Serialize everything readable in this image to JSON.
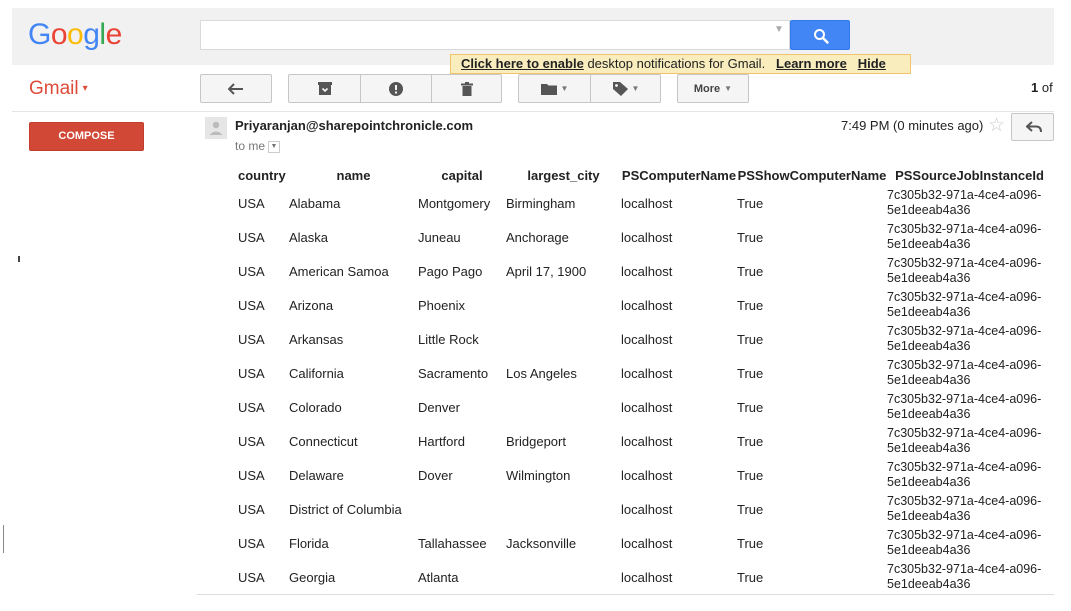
{
  "header": {
    "logo_letters": [
      {
        "ch": "G",
        "color": "#4285f4"
      },
      {
        "ch": "o",
        "color": "#ea4335"
      },
      {
        "ch": "o",
        "color": "#fbbc05"
      },
      {
        "ch": "g",
        "color": "#4285f4"
      },
      {
        "ch": "l",
        "color": "#34a853"
      },
      {
        "ch": "e",
        "color": "#ea4335"
      }
    ],
    "search_value": "",
    "search_icon": "search-icon"
  },
  "notification": {
    "link_text": "Click here to enable",
    "rest_text": " desktop notifications for Gmail.",
    "learn_more": "Learn more",
    "hide": "Hide"
  },
  "app": {
    "label": "Gmail",
    "caret": "▾",
    "compose": "COMPOSE"
  },
  "toolbar": {
    "more_label": "More",
    "pager_current": "1",
    "pager_of": " of"
  },
  "message": {
    "sender": "Priyaranjan@sharepointchronicle.com",
    "to": "to me",
    "time": "7:49 PM (0 minutes ago)",
    "star": "☆"
  },
  "table": {
    "headers": [
      "country",
      "name",
      "capital",
      "largest_city",
      "PSComputerName",
      "PSShowComputerName",
      "PSSourceJobInstanceId"
    ],
    "rows": [
      [
        "USA",
        "Alabama",
        "Montgomery",
        "Birmingham",
        "localhost",
        "True",
        "7c305b32-971a-4ce4-a096-5e1deeab4a36"
      ],
      [
        "USA",
        "Alaska",
        "Juneau",
        "Anchorage",
        "localhost",
        "True",
        "7c305b32-971a-4ce4-a096-5e1deeab4a36"
      ],
      [
        "USA",
        "American Samoa",
        "Pago Pago",
        "April 17, 1900",
        "localhost",
        "True",
        "7c305b32-971a-4ce4-a096-5e1deeab4a36"
      ],
      [
        "USA",
        "Arizona",
        "Phoenix",
        "",
        "localhost",
        "True",
        "7c305b32-971a-4ce4-a096-5e1deeab4a36"
      ],
      [
        "USA",
        "Arkansas",
        "Little Rock",
        "",
        "localhost",
        "True",
        "7c305b32-971a-4ce4-a096-5e1deeab4a36"
      ],
      [
        "USA",
        "California",
        "Sacramento",
        "Los Angeles",
        "localhost",
        "True",
        "7c305b32-971a-4ce4-a096-5e1deeab4a36"
      ],
      [
        "USA",
        "Colorado",
        "Denver",
        "",
        "localhost",
        "True",
        "7c305b32-971a-4ce4-a096-5e1deeab4a36"
      ],
      [
        "USA",
        "Connecticut",
        "Hartford",
        "Bridgeport",
        "localhost",
        "True",
        "7c305b32-971a-4ce4-a096-5e1deeab4a36"
      ],
      [
        "USA",
        "Delaware",
        "Dover",
        "Wilmington",
        "localhost",
        "True",
        "7c305b32-971a-4ce4-a096-5e1deeab4a36"
      ],
      [
        "USA",
        "District of Columbia",
        "",
        "",
        "localhost",
        "True",
        "7c305b32-971a-4ce4-a096-5e1deeab4a36"
      ],
      [
        "USA",
        "Florida",
        "Tallahassee",
        "Jacksonville",
        "localhost",
        "True",
        "7c305b32-971a-4ce4-a096-5e1deeab4a36"
      ],
      [
        "USA",
        "Georgia",
        "Atlanta",
        "",
        "localhost",
        "True",
        "7c305b32-971a-4ce4-a096-5e1deeab4a36"
      ]
    ]
  },
  "colors": {
    "accent_blue": "#4285f4",
    "gmail_red": "#dd4b39",
    "compose_red": "#d14836",
    "notification_bg": "#f9edbe"
  }
}
